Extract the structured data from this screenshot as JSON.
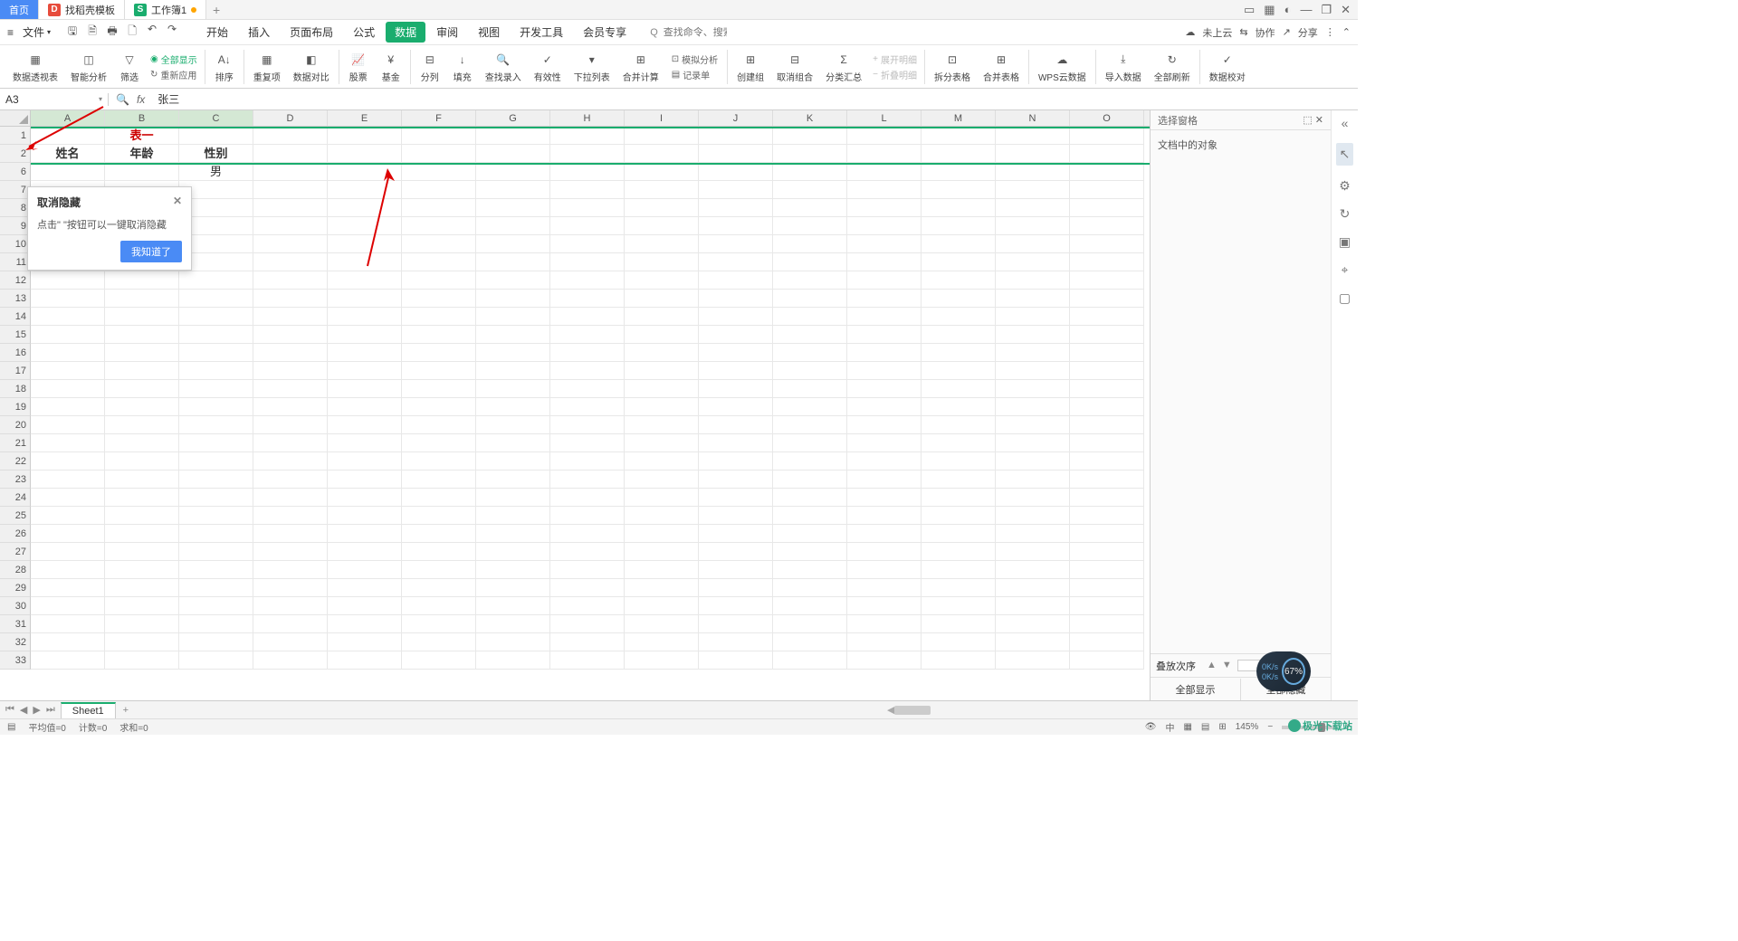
{
  "titlebar": {
    "home_tab": "首页",
    "template_tab": "找稻壳模板",
    "workbook_tab": "工作簿1",
    "plus": "+"
  },
  "title_right_icons": [
    "layout-icon",
    "grid-icon",
    "user-icon",
    "minimize-icon",
    "restore-icon",
    "close-icon"
  ],
  "menubar": {
    "file": "文件",
    "tabs": [
      "开始",
      "插入",
      "页面布局",
      "公式",
      "数据",
      "审阅",
      "视图",
      "开发工具",
      "会员专享"
    ],
    "active_idx": 4,
    "search_placeholder": "查找命令、搜索模板",
    "search_prefix": "Q 查找命令、",
    "cloud": "未上云",
    "collab": "协作",
    "share": "分享"
  },
  "ribbon": {
    "left_extra": {
      "show_all": "全部显示",
      "reapply": "重新应用"
    },
    "groups": [
      {
        "label": "数据透视表"
      },
      {
        "label": "智能分析"
      },
      {
        "label": "筛选"
      },
      {
        "label": "排序"
      },
      {
        "label": "重复项"
      },
      {
        "label": "数据对比"
      },
      {
        "label": "股票"
      },
      {
        "label": "基金"
      },
      {
        "label": "分列"
      },
      {
        "label": "填充"
      },
      {
        "label": "查找录入"
      },
      {
        "label": "有效性"
      },
      {
        "label": "下拉列表"
      },
      {
        "label": "合并计算"
      },
      {
        "label": "记录单"
      },
      {
        "label": "创建组"
      },
      {
        "label": "取消组合"
      },
      {
        "label": "分类汇总"
      },
      {
        "label": "拆分表格"
      },
      {
        "label": "合并表格"
      },
      {
        "label": "WPS云数据"
      },
      {
        "label": "导入数据"
      },
      {
        "label": "全部刷新"
      },
      {
        "label": "数据校对"
      }
    ],
    "sim": "模拟分析",
    "expand": "展开明细",
    "collapse": "折叠明细"
  },
  "formula": {
    "cellref": "A3",
    "fx": "fx",
    "value": "张三"
  },
  "columns": [
    "A",
    "B",
    "C",
    "D",
    "E",
    "F",
    "G",
    "H",
    "I",
    "J",
    "K",
    "L",
    "M",
    "N",
    "O"
  ],
  "visible_row_nums": [
    1,
    2,
    6,
    7,
    8,
    9,
    10,
    11,
    12,
    13,
    14,
    15,
    16,
    17,
    18,
    19,
    20,
    21,
    22,
    23,
    24,
    25,
    26,
    27,
    28,
    29,
    30,
    31,
    32,
    33
  ],
  "cells": {
    "title": "表一",
    "h_name": "姓名",
    "h_age": "年龄",
    "h_sex": "性别",
    "r6c": "男"
  },
  "popup": {
    "title": "取消隐藏",
    "body": "点击\" \"按钮可以一键取消隐藏",
    "btn": "我知道了"
  },
  "sidepane": {
    "title": "选择窗格",
    "body": "文档中的对象",
    "stack": "叠放次序",
    "show_all": "全部显示",
    "hide_all": "全部隐藏"
  },
  "sheet": {
    "name": "Sheet1"
  },
  "status": {
    "avg": "平均值=0",
    "cnt": "计数=0",
    "sum": "求和=0",
    "zoom": "145%",
    "lang": "中"
  },
  "badge": {
    "up": "0K/s",
    "dn": "0K/s",
    "pct": "67%"
  },
  "logo": "极光下载站"
}
